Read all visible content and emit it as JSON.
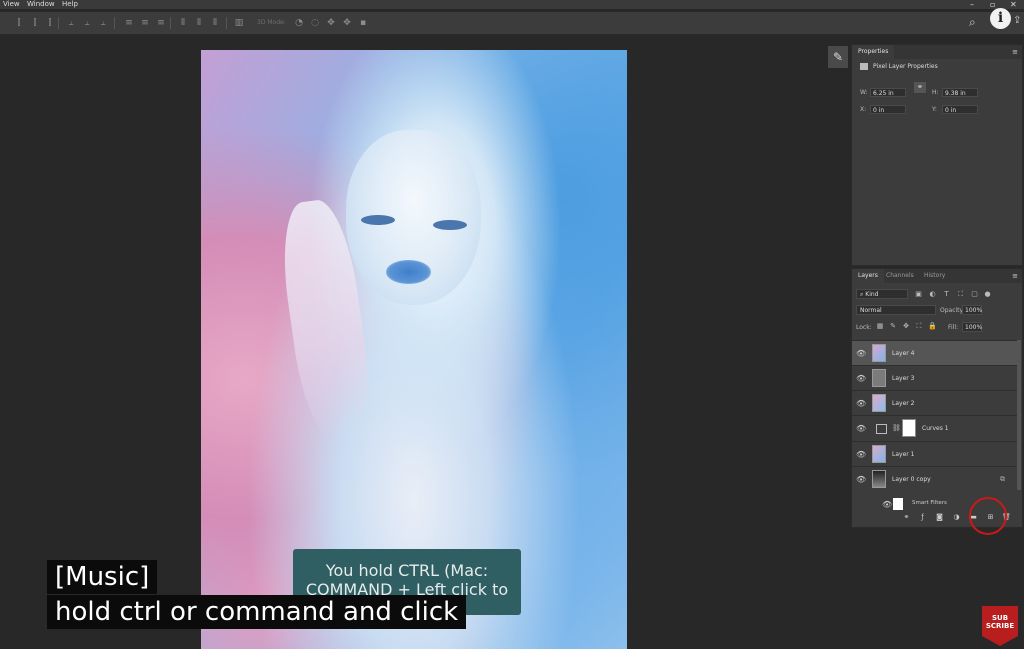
{
  "menu": {
    "items": [
      "View",
      "Window",
      "Help"
    ]
  },
  "options_bar": {
    "label_3d": "3D Mode:"
  },
  "subtitles": {
    "line1": "[Music]",
    "line2": "hold ctrl or command and click"
  },
  "tooltip": {
    "line1": "You hold CTRL (Mac:",
    "line2": "COMMAND + Left click to"
  },
  "properties_panel": {
    "tab": "Properties",
    "title": "Pixel Layer Properties",
    "w_label": "W:",
    "w_value": "6.25 in",
    "h_label": "H:",
    "h_value": "9.38 in",
    "x_label": "X:",
    "x_value": "0 in",
    "y_label": "Y:",
    "y_value": "0 in"
  },
  "layers_panel": {
    "tabs": [
      "Layers",
      "Channels",
      "History"
    ],
    "kind_filter": "Kind",
    "blend_mode": "Normal",
    "opacity_label": "Opacity:",
    "opacity_value": "100%",
    "lock_label": "Lock:",
    "fill_label": "Fill:",
    "fill_value": "100%",
    "layers": [
      {
        "name": "Layer 4",
        "selected": true
      },
      {
        "name": "Layer 3",
        "selected": false
      },
      {
        "name": "Layer 2",
        "selected": false
      },
      {
        "name": "Curves 1",
        "selected": false
      },
      {
        "name": "Layer 1",
        "selected": false
      },
      {
        "name": "Layer 0 copy",
        "selected": false
      }
    ],
    "smart_filter_label": "Smart Filters"
  },
  "subscribe_badge": {
    "line1": "SUB",
    "line2": "SCRIBE"
  },
  "colors": {
    "highlight_circle": "#d01818",
    "tooltip_bg": "#2f5f62",
    "subscribe": "#b81e1e"
  }
}
